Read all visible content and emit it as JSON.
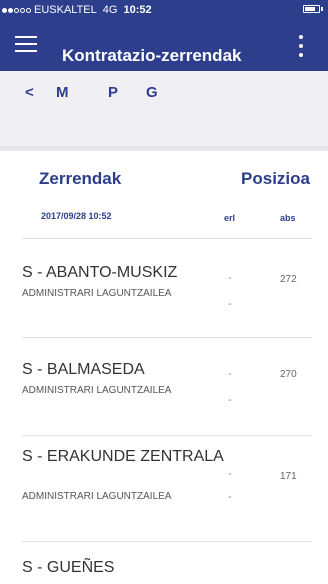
{
  "status_bar": {
    "carrier": "EUSKALTEL",
    "network": "4G",
    "time": "10:52",
    "signal_bars": 2,
    "signal_total": 5,
    "battery_level": 0.8
  },
  "toolbar": {
    "title": "Kontratazio-zerrendak",
    "menu_icon": "hamburger-icon",
    "more_icon": "vertical-dots-icon"
  },
  "filters": {
    "back": "<",
    "m": "M",
    "p": "P",
    "g": "G"
  },
  "table": {
    "title": "Zerrendak",
    "date": "2017/09/28 10:52",
    "position_header": "Posizioa",
    "relative_header": "erl",
    "absolute_header": "abs",
    "rows": [
      {
        "name": "S - ABANTO-MUSKIZ",
        "category": "ADMINISTRARI LAGUNTZAILEA",
        "rel": "-",
        "rel2": "-",
        "abs": "272"
      },
      {
        "name": "S - BALMASEDA",
        "category": "ADMINISTRARI LAGUNTZAILEA",
        "rel": "-",
        "rel2": "-",
        "abs": "270"
      },
      {
        "name": "S - ERAKUNDE ZENTRALA",
        "category": "ADMINISTRARI LAGUNTZAILEA",
        "rel": "-",
        "rel2": "-",
        "abs": "171"
      },
      {
        "name": "S - GUEÑES",
        "category": "",
        "rel": "",
        "rel2": "",
        "abs": ""
      }
    ]
  },
  "colors": {
    "primary": "#2c3e8c",
    "background": "#ffffff",
    "filter_bar": "#efeff4"
  }
}
